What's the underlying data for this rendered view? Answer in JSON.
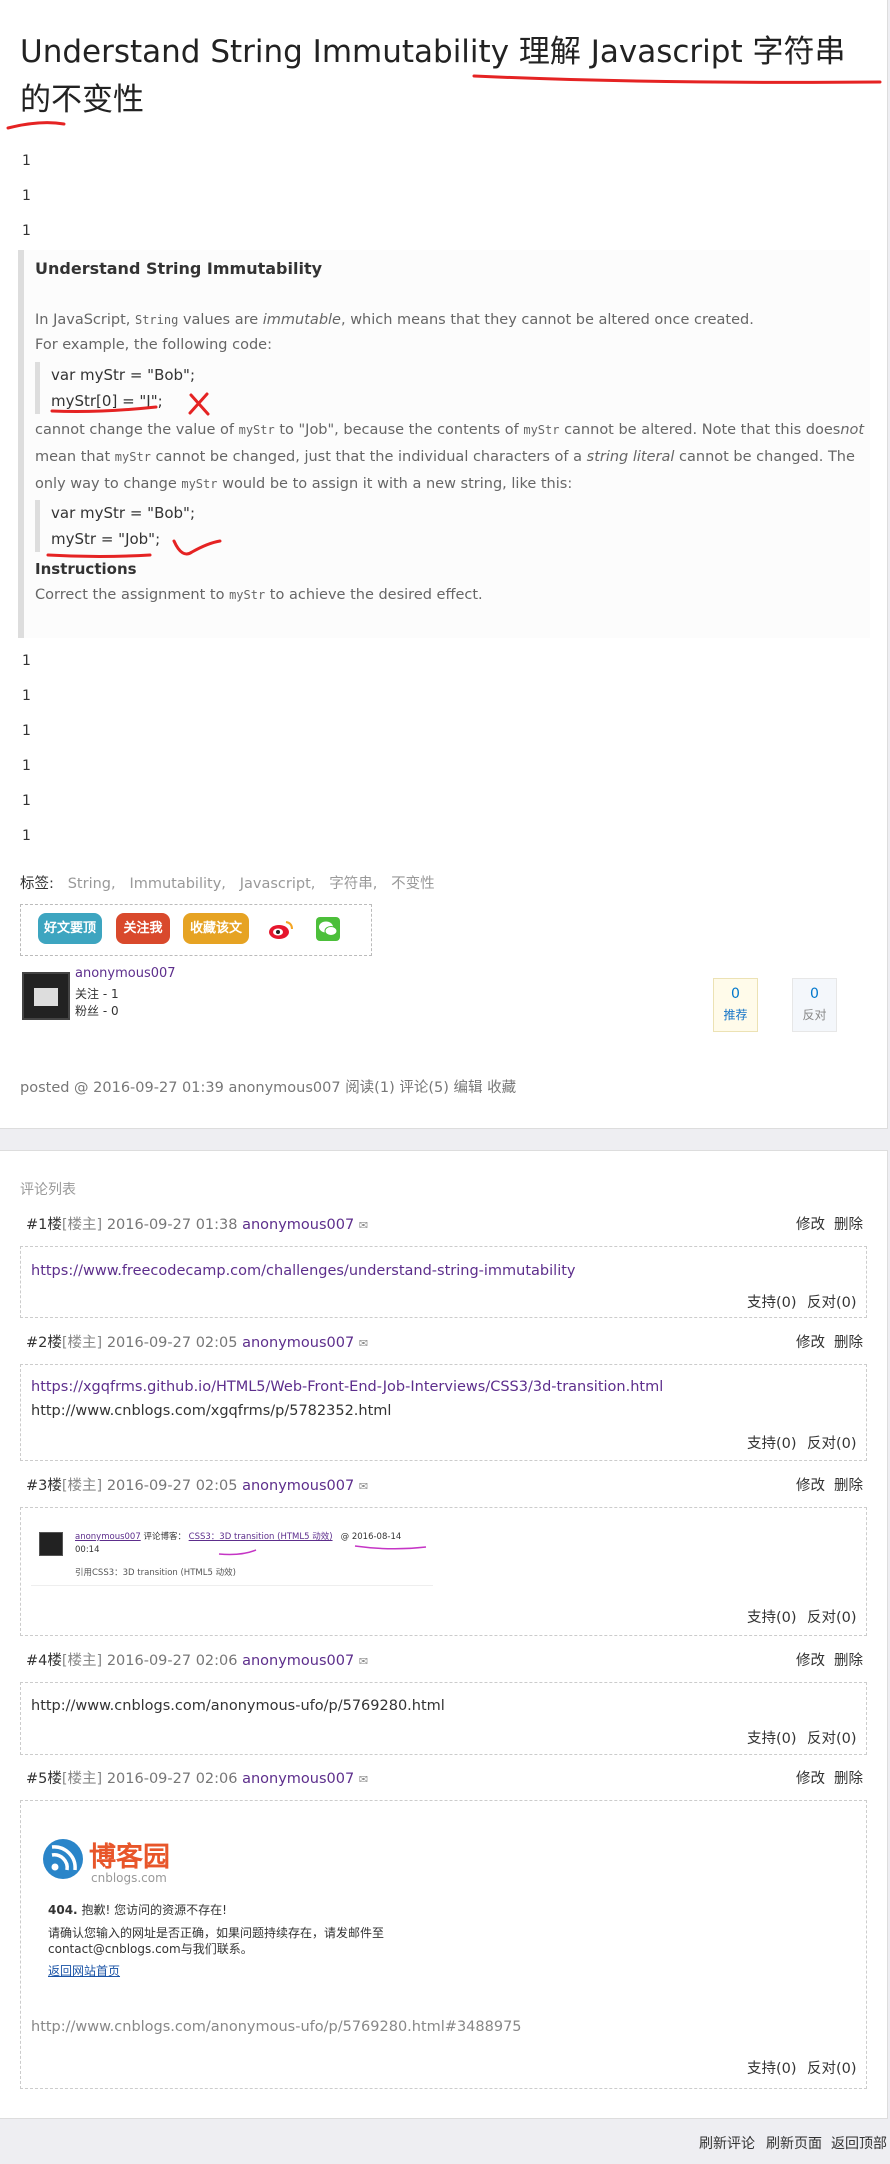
{
  "post": {
    "title_en": "Understand String Immutability",
    "title_cn": "理解 Javascript 字符串的不变性",
    "ones": [
      "1",
      "1",
      "1",
      "1",
      "1",
      "1",
      "1",
      "1",
      "1"
    ],
    "quote": {
      "heading": "Understand String Immutability",
      "p1_a": "In JavaScript, ",
      "p1_code": "String",
      "p1_b": " values are ",
      "p1_em": "immutable",
      "p1_c": ", which means that they cannot be altered once created.",
      "p2": "For example, the following code:",
      "code1": [
        "var myStr = \"Bob\";",
        "myStr[0] = \"J\";"
      ],
      "p3_a": "cannot change the value of ",
      "p3_code1": "myStr",
      "p3_b": " to \"Job\", because the contents of ",
      "p3_code2": "myStr",
      "p3_c": " cannot be altered. Note that this does",
      "p3_em1": "not",
      "p3_line2_a": "mean that ",
      "p3_code3": "myStr",
      "p3_line2_b": " cannot be changed, just that the individual characters of a ",
      "p3_em2": "string literal",
      "p3_line2_c": " cannot be changed. The",
      "p3_line3_a": "only way to change ",
      "p3_code4": "myStr",
      "p3_line3_b": " would be to assign it with a new string, like this:",
      "code2": [
        "var myStr = \"Bob\";",
        "myStr = \"Job\";"
      ],
      "instructions": "Instructions",
      "instr_a": "Correct the assignment to ",
      "instr_code": "myStr",
      "instr_b": " to achieve the desired effect."
    },
    "tags_label": "标签:",
    "tags": [
      "String",
      "Immutability",
      "Javascript",
      "字符串",
      "不变性"
    ],
    "buttons": {
      "good": "好文要顶",
      "follow": "关注我",
      "fav": "收藏该文"
    },
    "author": {
      "name": "anonymous007",
      "follow": "关注 - 1",
      "fans": "粉丝 - 0"
    },
    "votes": {
      "digg_count": "0",
      "digg_label": "推荐",
      "bury_count": "0",
      "bury_label": "反对"
    },
    "posted": {
      "prefix": "posted @ 2016-09-27 01:39",
      "author": "anonymous007",
      "stats": "阅读(1) 评论(5) 编辑 收藏"
    }
  },
  "comments": {
    "title": "评论列表",
    "edit": "修改",
    "del": "删除",
    "support": "支持(0)",
    "oppose": "反对(0)",
    "lz": "[楼主]",
    "items": [
      {
        "floor": "#1楼",
        "date": "2016-09-27 01:38",
        "author": "anonymous007",
        "lines": [
          "https://www.freecodecamp.com/challenges/understand-string-immutability"
        ]
      },
      {
        "floor": "#2楼",
        "date": "2016-09-27 02:05",
        "author": "anonymous007",
        "lines": [
          "https://xgqfrms.github.io/HTML5/Web-Front-End-Job-Interviews/CSS3/3d-transition.html",
          "http://www.cnblogs.com/xgqfrms/p/5782352.html"
        ]
      },
      {
        "floor": "#3楼",
        "date": "2016-09-27 02:05",
        "author": "anonymous007",
        "embed": {
          "user": "anonymous007",
          "mid": "评论博客：",
          "link": "CSS3：3D transition (HTML5 动效)",
          "at": "@ 2016-08-14",
          "time": "00:14",
          "quote": "引用CSS3：3D transition (HTML5 动效)"
        }
      },
      {
        "floor": "#4楼",
        "date": "2016-09-27 02:06",
        "author": "anonymous007",
        "lines": [
          "http://www.cnblogs.com/anonymous-ufo/p/5769280.html"
        ]
      },
      {
        "floor": "#5楼",
        "date": "2016-09-27 02:06",
        "author": "anonymous007",
        "embed404": {
          "brand": "博客园",
          "domain": "cnblogs.com",
          "code": "404.",
          "msg": "抱歉! 您访问的资源不存在!",
          "line1": "请确认您输入的网址是否正确，如果问题持续存在，请发邮件至",
          "line2": "contact@cnblogs.com与我们联系。",
          "back": "返回网站首页"
        },
        "url": "http://www.cnblogs.com/anonymous-ufo/p/5769280.html#3488975"
      }
    ]
  },
  "footer": {
    "refresh_comments": "刷新评论",
    "refresh_page": "刷新页面",
    "back_top": "返回顶部"
  },
  "colors": {
    "link": "#5d2e8c",
    "red_annotation": "#e52323",
    "purple_annotation": "#c535c5"
  }
}
